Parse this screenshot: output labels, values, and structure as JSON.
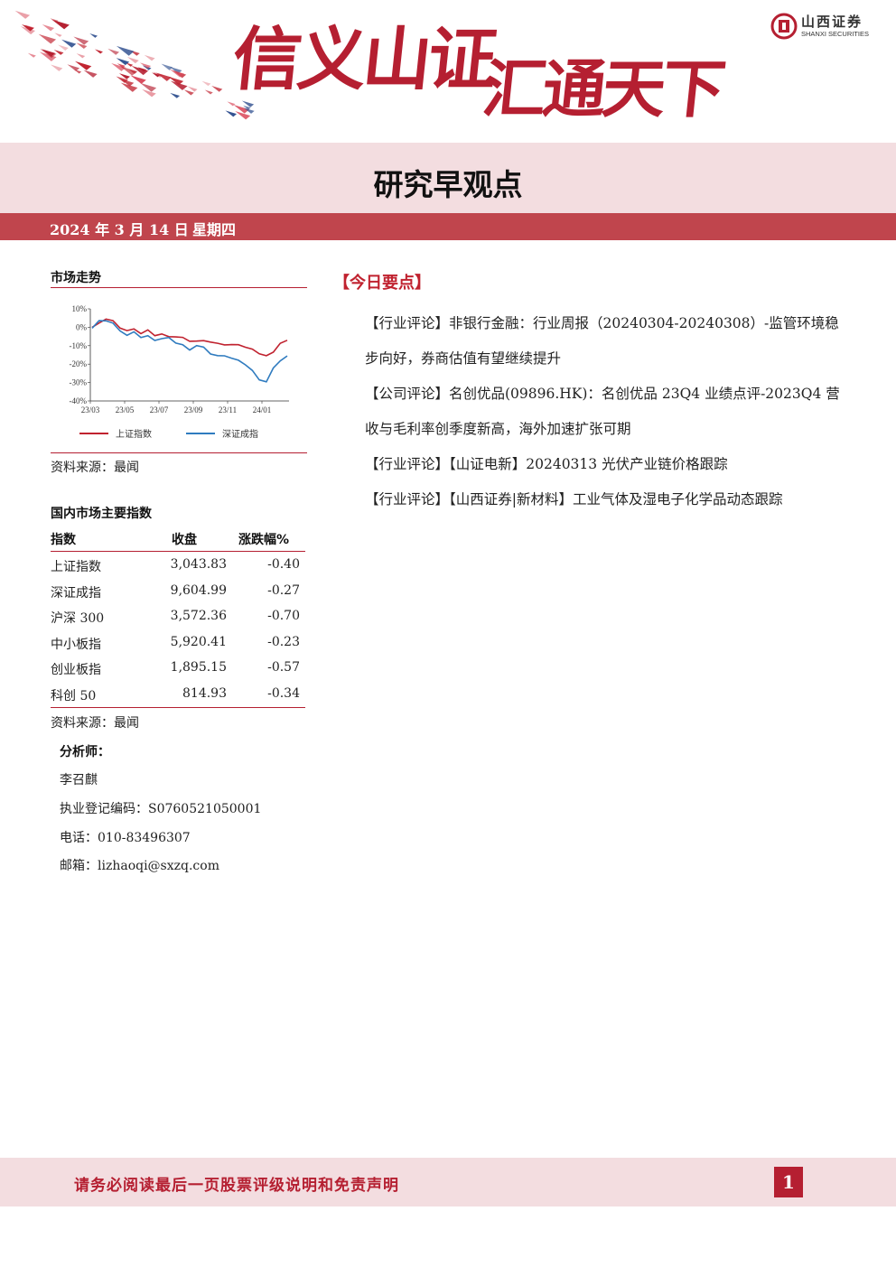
{
  "header": {
    "slogan_part1": "信义山证",
    "slogan_part2": "汇通天下",
    "logo_cn": "山西证券",
    "logo_en": "SHANXI SECURITIES",
    "brand_color": "#b51f31"
  },
  "report": {
    "title": "研究早观点",
    "date": "2024 年 3 月 14 日",
    "weekday": "星期四"
  },
  "market_trend": {
    "title": "市场走势",
    "source": "资料来源：最闻"
  },
  "chart_data": {
    "type": "line",
    "x": [
      "23/03",
      "23/05",
      "23/07",
      "23/09",
      "23/11",
      "24/01"
    ],
    "x_ticks": [
      "23/03",
      "23/05",
      "23/07",
      "23/09",
      "23/11",
      "24/01"
    ],
    "y_ticks": [
      "10%",
      "0%",
      "-10%",
      "-20%",
      "-30%",
      "-40%"
    ],
    "ylim": [
      -40,
      10
    ],
    "series": [
      {
        "name": "上证指数",
        "color": "#c0222f",
        "values": [
          0,
          2,
          5,
          3,
          0,
          -2,
          -1,
          -3,
          -2,
          -4,
          -4,
          -5,
          -5,
          -6,
          -7,
          -8,
          -7,
          -8,
          -9,
          -9,
          -10,
          -9,
          -11,
          -12,
          -14,
          -16,
          -13,
          -9,
          -7
        ]
      },
      {
        "name": "深证成指",
        "color": "#2f7bbf",
        "values": [
          0,
          3,
          4,
          2,
          -2,
          -4,
          -3,
          -5,
          -5,
          -7,
          -6,
          -6,
          -8,
          -10,
          -12,
          -10,
          -11,
          -14,
          -16,
          -15,
          -17,
          -18,
          -20,
          -24,
          -28,
          -30,
          -22,
          -18,
          -16
        ]
      }
    ],
    "grid": false,
    "legend_position": "bottom"
  },
  "index_table": {
    "title": "国内市场主要指数",
    "headers": [
      "指数",
      "收盘",
      "涨跌幅%"
    ],
    "rows": [
      [
        "上证指数",
        "3,043.83",
        "-0.40"
      ],
      [
        "深证成指",
        "9,604.99",
        "-0.27"
      ],
      [
        "沪深 300",
        "3,572.36",
        "-0.70"
      ],
      [
        "中小板指",
        "5,920.41",
        "-0.23"
      ],
      [
        "创业板指",
        "1,895.15",
        "-0.57"
      ],
      [
        "科创 50",
        "814.93",
        "-0.34"
      ]
    ],
    "source": "资料来源：最闻"
  },
  "analyst": {
    "heading": "分析师：",
    "name": "李召麒",
    "reg": "执业登记编码：S0760521050001",
    "phone": "电话：010-83496307",
    "email": "邮箱：lizhaoqi@sxzq.com"
  },
  "key_points": {
    "title": "【今日要点】",
    "items": [
      "【行业评论】非银行金融：行业周报（20240304-20240308）-监管环境稳步向好，券商估值有望继续提升",
      "【公司评论】名创优品(09896.HK)：名创优品 23Q4 业绩点评-2023Q4 营收与毛利率创季度新高，海外加速扩张可期",
      "【行业评论】【山证电新】20240313 光伏产业链价格跟踪",
      "【行业评论】【山西证券|新材料】工业气体及湿电子化学品动态跟踪"
    ]
  },
  "footer": {
    "notice": "请务必阅读最后一页股票评级说明和免责声明",
    "page": "1"
  }
}
